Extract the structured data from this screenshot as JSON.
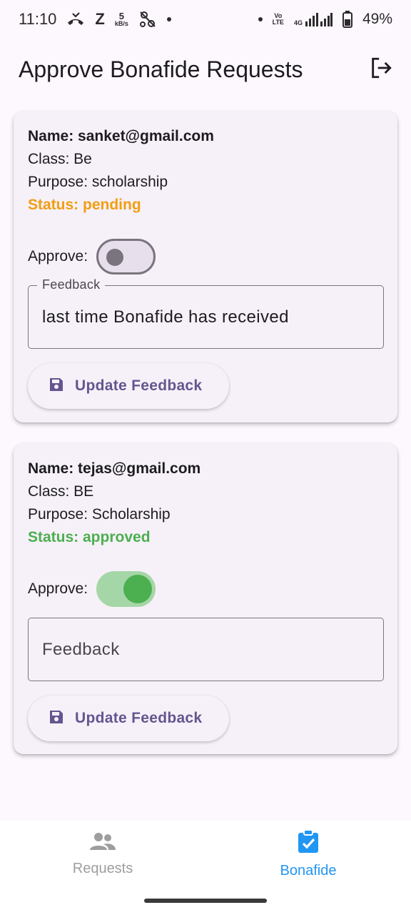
{
  "status_bar": {
    "time": "11:10",
    "z_label": "Z",
    "net_speed_value": "5",
    "net_speed_unit": "kB/s",
    "volte_top": "Vo",
    "volte_bottom": "LTE",
    "network_type": "4G",
    "battery_percent": "49%"
  },
  "app_bar": {
    "title": "Approve Bonafide Requests",
    "logout_icon": "logout-icon"
  },
  "requests": [
    {
      "name_line": "Name: sanket@gmail.com",
      "class_line": "Class: Be",
      "purpose_line": "Purpose: scholarship",
      "status_line": "Status: pending",
      "status_color": "#f29d12",
      "approve_label": "Approve:",
      "approved": false,
      "feedback_label": "Feedback",
      "feedback_value": "last time Bonafide has received",
      "update_button_label": "Update Feedback"
    },
    {
      "name_line": "Name: tejas@gmail.com",
      "class_line": "Class: BE",
      "purpose_line": "Purpose: Scholarship",
      "status_line": "Status: approved",
      "status_color": "#4caf50",
      "approve_label": "Approve:",
      "approved": true,
      "feedback_placeholder": "Feedback",
      "feedback_value": "",
      "update_button_label": "Update Feedback"
    }
  ],
  "bottom_nav": {
    "items": [
      {
        "label": "Requests",
        "icon": "people-icon",
        "active": false
      },
      {
        "label": "Bonafide",
        "icon": "clipboard-check-icon",
        "active": true
      }
    ]
  },
  "colors": {
    "accent": "#65558f",
    "active_nav": "#2196f3",
    "inactive_nav": "#9e9e9e",
    "pending": "#f29d12",
    "approved": "#4caf50"
  }
}
